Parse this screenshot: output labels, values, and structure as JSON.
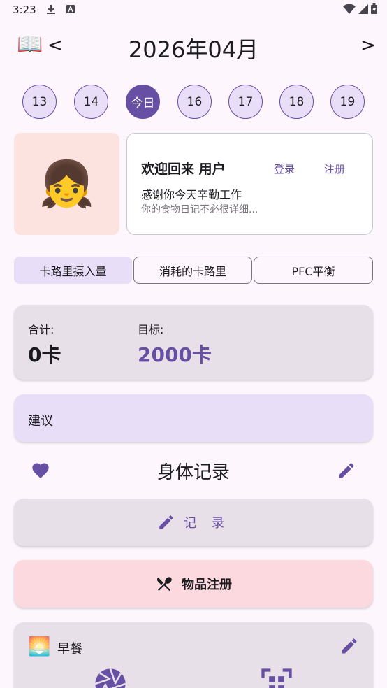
{
  "status_bar": {
    "time": "3:23"
  },
  "header": {
    "prev_label": "<",
    "next_label": ">",
    "month_title": "2026年04月"
  },
  "days": [
    "13",
    "14",
    "今日",
    "16",
    "17",
    "18",
    "19"
  ],
  "profile": {
    "avatar_emoji": "👧",
    "welcome": "欢迎回来 用户",
    "login": "登录",
    "register": "注册",
    "thanks": "感谢你今天辛勤工作",
    "subtitle": "你的食物日记不必很详细..."
  },
  "tabs": [
    "卡路里摄入量",
    "消耗的卡路里",
    "PFC平衡"
  ],
  "totals": {
    "total_label": "合计:",
    "total_value": "0卡",
    "goal_label": "目标:",
    "goal_value": "2000卡"
  },
  "advice": {
    "label": "建议"
  },
  "body_record": {
    "title": "身体记录",
    "record_button": "记 录"
  },
  "item_register": {
    "label": "物品注册"
  },
  "meal": {
    "icon_emoji": "🌅",
    "label": "早餐"
  },
  "colors": {
    "accent": "#6750a4",
    "chip_bg": "#e8def8",
    "card_gray": "#e7e0e8",
    "pink_button": "#fcd8df",
    "avatar_bg": "#fde3df"
  }
}
